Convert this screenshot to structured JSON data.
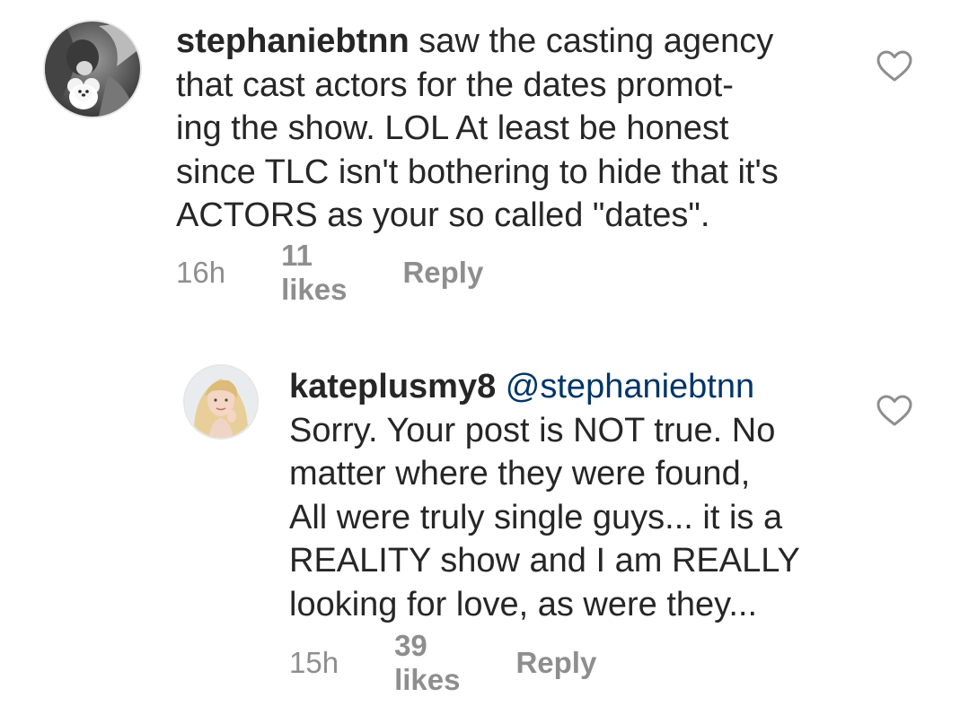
{
  "comments": [
    {
      "username": "stephaniebtnn",
      "lines": [
        " saw the casting agency",
        "that cast actors for the dates promot-",
        "ing the show.  LOL  At least be honest",
        "since TLC isn't bothering to hide that it's",
        "ACTORS as your so called \"dates\"."
      ],
      "time": "16h",
      "likes": "11 likes",
      "reply": "Reply",
      "avatar_icon": "user-avatar-bear"
    },
    {
      "username": "kateplusmy8",
      "mention": "@stephaniebtnn",
      "lines": [
        "Sorry. Your post is NOT true. No",
        "matter where they were found,",
        "All were truly single guys... it is a",
        "REALITY show and I am REALLY",
        "looking for love, as were they..."
      ],
      "time": "15h",
      "likes": "39 likes",
      "reply": "Reply",
      "avatar_icon": "user-avatar-blonde"
    }
  ],
  "colors": {
    "text": "#262626",
    "meta": "#8e8e8e",
    "mention": "#003569"
  }
}
